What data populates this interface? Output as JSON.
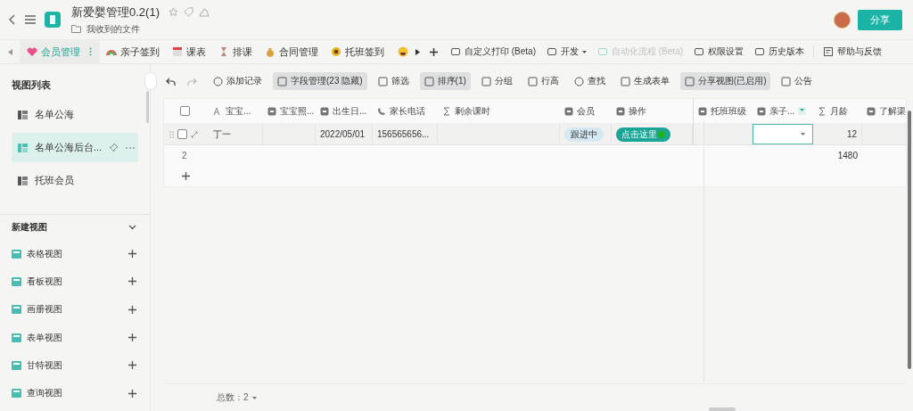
{
  "header": {
    "title": "新爱婴管理0.2(1)",
    "folder": "我收到的文件",
    "share_button": "分享"
  },
  "tabs": [
    {
      "label": "会员管理",
      "selected": true
    },
    {
      "label": "亲子签到",
      "selected": false
    },
    {
      "label": "课表",
      "selected": false
    },
    {
      "label": "排课",
      "selected": false
    },
    {
      "label": "合同管理",
      "selected": false
    },
    {
      "label": "托班签到",
      "selected": false
    }
  ],
  "tab_actions": [
    {
      "label": "自定义打印 (Beta)",
      "disabled": false,
      "dropdown": false
    },
    {
      "label": "开发",
      "disabled": false,
      "dropdown": true
    },
    {
      "label": "自动化流程 (Beta)",
      "disabled": true,
      "dropdown": false
    },
    {
      "label": "权限设置",
      "disabled": false,
      "dropdown": false
    },
    {
      "label": "历史版本",
      "disabled": false,
      "dropdown": false
    }
  ],
  "help": "帮助与反馈",
  "sidebar": {
    "title": "视图列表",
    "views": [
      {
        "label": "名单公海",
        "selected": false
      },
      {
        "label": "名单公海后台...",
        "selected": true
      },
      {
        "label": "托班会员",
        "selected": false
      }
    ],
    "new_view_title": "新建视图",
    "view_types": [
      {
        "label": "表格视图"
      },
      {
        "label": "看板视图"
      },
      {
        "label": "画册视图"
      },
      {
        "label": "表单视图"
      },
      {
        "label": "甘特视图"
      },
      {
        "label": "查询视图"
      }
    ]
  },
  "toolbar": [
    {
      "label": "添加记录",
      "active": false
    },
    {
      "label": "字段管理(23 隐藏)",
      "active": true
    },
    {
      "label": "筛选",
      "active": false
    },
    {
      "label": "排序(1)",
      "active": true
    },
    {
      "label": "分组",
      "active": false
    },
    {
      "label": "行高",
      "active": false
    },
    {
      "label": "查找",
      "active": false
    },
    {
      "label": "生成表单",
      "active": false
    },
    {
      "label": "分享视图(已启用)",
      "active": true
    },
    {
      "label": "公告",
      "active": false
    }
  ],
  "table": {
    "all_checked": false,
    "columns": [
      {
        "label": "宝宝...",
        "kind": "text"
      },
      {
        "label": "宝宝照...",
        "kind": "attachment"
      },
      {
        "label": "出生日...",
        "kind": "date"
      },
      {
        "label": "家长电话",
        "kind": "phone"
      },
      {
        "label": "剩余课时",
        "kind": "formula"
      },
      {
        "label": "会员",
        "kind": "select"
      },
      {
        "label": "操作",
        "kind": "select"
      },
      {
        "label": "托班班级",
        "kind": "select"
      },
      {
        "label": "亲子...",
        "kind": "select"
      },
      {
        "label": "月龄",
        "kind": "formula"
      },
      {
        "label": "了解渠",
        "kind": "select"
      }
    ],
    "rows": [
      {
        "checked": false,
        "cells": [
          {
            "kind": "text",
            "text": "丁一",
            "selected": false
          },
          {
            "kind": "empty",
            "selected": false
          },
          {
            "kind": "text",
            "text": "2022/05/01",
            "selected": false
          },
          {
            "kind": "text",
            "text": "156565656...",
            "selected": false
          },
          {
            "kind": "empty",
            "selected": false
          },
          {
            "kind": "tag",
            "text": "跟进中",
            "selected": false
          },
          {
            "kind": "button",
            "text": "点击这里",
            "selected": false
          },
          {
            "kind": "empty",
            "selected": false
          },
          {
            "kind": "dropdown",
            "selected": true
          },
          {
            "kind": "number",
            "text": "12",
            "selected": false
          },
          {
            "kind": "empty",
            "selected": false
          }
        ]
      }
    ],
    "summary": {
      "count": "2",
      "values": [
        {
          "kind": "empty"
        },
        {
          "kind": "empty"
        },
        {
          "kind": "empty"
        },
        {
          "kind": "empty"
        },
        {
          "kind": "empty"
        },
        {
          "kind": "empty"
        },
        {
          "kind": "empty"
        },
        {
          "kind": "empty"
        },
        {
          "kind": "empty"
        },
        {
          "kind": "number",
          "text": "1480"
        },
        {
          "kind": "empty"
        }
      ]
    },
    "footer": "总数：2"
  }
}
